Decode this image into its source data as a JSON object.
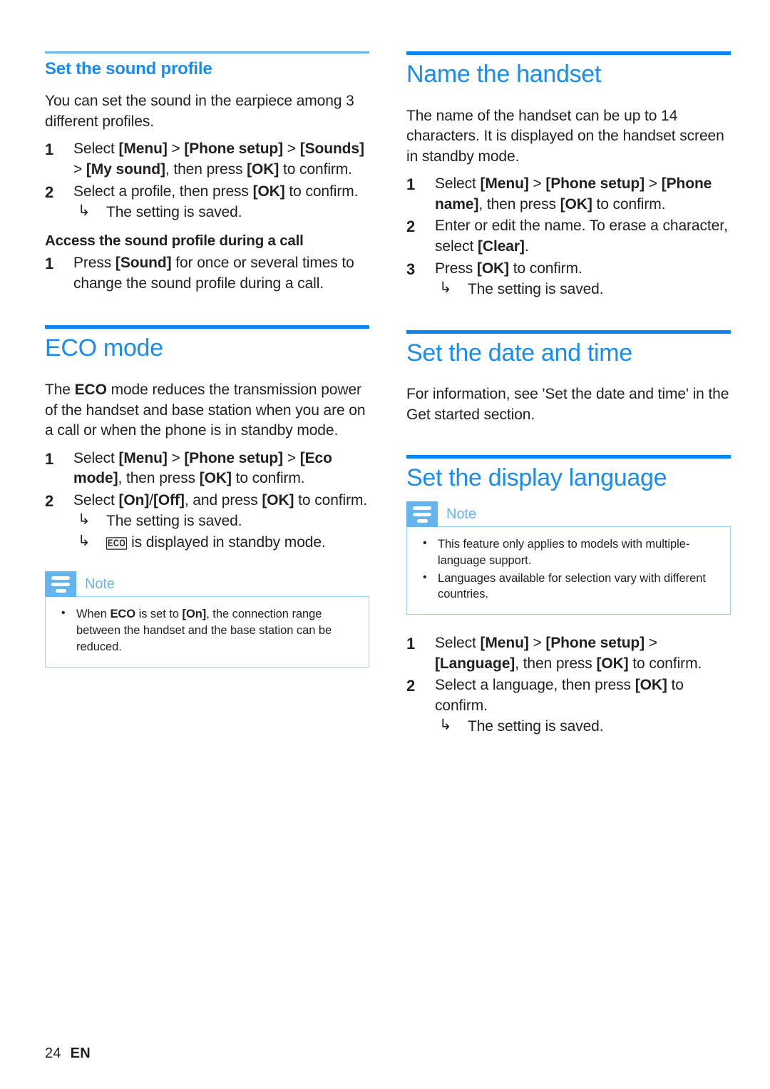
{
  "page": {
    "footer": {
      "page_number": "24",
      "language_code": "EN"
    },
    "accent_color": "#1a8cf0",
    "rule_color": "#0a84f0",
    "note_color": "#64b4f0"
  },
  "left_column": {
    "sound_profile": {
      "heading": "Set the sound profile",
      "intro": "You can set the sound in the earpiece among 3 different profiles.",
      "steps": [
        {
          "num": "1",
          "parts": [
            {
              "t": "Select ",
              "b": false
            },
            {
              "t": "[Menu]",
              "b": true
            },
            {
              "t": " > ",
              "b": false
            },
            {
              "t": "[Phone setup]",
              "b": true
            },
            {
              "t": " > ",
              "b": false
            },
            {
              "t": "[Sounds]",
              "b": true
            },
            {
              "t": " > ",
              "b": false
            },
            {
              "t": "[My sound]",
              "b": true
            },
            {
              "t": ", then press ",
              "b": false
            },
            {
              "t": "[OK]",
              "b": true
            },
            {
              "t": " to confirm.",
              "b": false
            }
          ]
        },
        {
          "num": "2",
          "parts": [
            {
              "t": "Select a profile, then press ",
              "b": false
            },
            {
              "t": "[OK]",
              "b": true
            },
            {
              "t": " to confirm.",
              "b": false
            }
          ],
          "substeps": [
            {
              "arrow": "↳",
              "text": "The setting is saved."
            }
          ]
        }
      ],
      "subheading": "Access the sound profile during a call",
      "sub_steps": [
        {
          "num": "1",
          "parts": [
            {
              "t": "Press ",
              "b": false
            },
            {
              "t": "[Sound]",
              "b": true
            },
            {
              "t": " for once or several times to change the sound profile during a call.",
              "b": false
            }
          ]
        }
      ]
    },
    "eco_mode": {
      "heading": "ECO mode",
      "intro_parts": [
        {
          "t": "The ",
          "b": false
        },
        {
          "t": "ECO",
          "b": true
        },
        {
          "t": " mode reduces the transmission power of the handset and base station when you are on a call or when the phone is in standby mode.",
          "b": false
        }
      ],
      "steps": [
        {
          "num": "1",
          "parts": [
            {
              "t": "Select ",
              "b": false
            },
            {
              "t": "[Menu]",
              "b": true
            },
            {
              "t": " > ",
              "b": false
            },
            {
              "t": "[Phone setup]",
              "b": true
            },
            {
              "t": " > ",
              "b": false
            },
            {
              "t": "[Eco mode]",
              "b": true
            },
            {
              "t": ", then press ",
              "b": false
            },
            {
              "t": "[OK]",
              "b": true
            },
            {
              "t": " to confirm.",
              "b": false
            }
          ]
        },
        {
          "num": "2",
          "parts": [
            {
              "t": "Select ",
              "b": false
            },
            {
              "t": "[On]",
              "b": true
            },
            {
              "t": "/",
              "b": false
            },
            {
              "t": "[Off]",
              "b": true
            },
            {
              "t": ", and press ",
              "b": false
            },
            {
              "t": "[OK]",
              "b": true
            },
            {
              "t": " to confirm.",
              "b": false
            }
          ],
          "substeps": [
            {
              "arrow": "↳",
              "text": "The setting is saved."
            },
            {
              "arrow": "↳",
              "icon": "ECO",
              "text": " is displayed in standby mode."
            }
          ]
        }
      ],
      "note": {
        "title": "Note",
        "items": [
          [
            {
              "t": "When ",
              "b": false
            },
            {
              "t": "ECO",
              "b": true
            },
            {
              "t": " is set to ",
              "b": false
            },
            {
              "t": "[On]",
              "b": true
            },
            {
              "t": ", the connection range between the handset and the base station can be reduced.",
              "b": false
            }
          ]
        ]
      }
    }
  },
  "right_column": {
    "name_handset": {
      "heading": "Name the handset",
      "intro": "The name of the handset can be up to 14 characters. It is displayed on the handset screen in standby mode.",
      "steps": [
        {
          "num": "1",
          "parts": [
            {
              "t": "Select ",
              "b": false
            },
            {
              "t": "[Menu]",
              "b": true
            },
            {
              "t": " > ",
              "b": false
            },
            {
              "t": "[Phone setup]",
              "b": true
            },
            {
              "t": " > ",
              "b": false
            },
            {
              "t": "[Phone name]",
              "b": true
            },
            {
              "t": ", then press ",
              "b": false
            },
            {
              "t": "[OK]",
              "b": true
            },
            {
              "t": " to confirm.",
              "b": false
            }
          ]
        },
        {
          "num": "2",
          "parts": [
            {
              "t": "Enter or edit the name. To erase a character, select ",
              "b": false
            },
            {
              "t": "[Clear]",
              "b": true
            },
            {
              "t": ".",
              "b": false
            }
          ]
        },
        {
          "num": "3",
          "parts": [
            {
              "t": "Press ",
              "b": false
            },
            {
              "t": "[OK]",
              "b": true
            },
            {
              "t": " to confirm.",
              "b": false
            }
          ],
          "substeps": [
            {
              "arrow": "↳",
              "text": "The setting is saved."
            }
          ]
        }
      ]
    },
    "date_time": {
      "heading": "Set the date and time",
      "intro": "For information, see 'Set the date and time' in the Get started section."
    },
    "display_language": {
      "heading": "Set the display language",
      "note": {
        "title": "Note",
        "items": [
          [
            {
              "t": "This feature only applies to models with multiple-language support.",
              "b": false
            }
          ],
          [
            {
              "t": "Languages available for selection vary with different countries.",
              "b": false
            }
          ]
        ]
      },
      "steps": [
        {
          "num": "1",
          "parts": [
            {
              "t": "Select ",
              "b": false
            },
            {
              "t": "[Menu]",
              "b": true
            },
            {
              "t": " > ",
              "b": false
            },
            {
              "t": "[Phone setup]",
              "b": true
            },
            {
              "t": " > ",
              "b": false
            },
            {
              "t": "[Language]",
              "b": true
            },
            {
              "t": ", then press ",
              "b": false
            },
            {
              "t": "[OK]",
              "b": true
            },
            {
              "t": " to confirm.",
              "b": false
            }
          ]
        },
        {
          "num": "2",
          "parts": [
            {
              "t": "Select a language, then press ",
              "b": false
            },
            {
              "t": "[OK]",
              "b": true
            },
            {
              "t": " to confirm.",
              "b": false
            }
          ],
          "substeps": [
            {
              "arrow": "↳",
              "text": "The setting is saved."
            }
          ]
        }
      ]
    }
  }
}
